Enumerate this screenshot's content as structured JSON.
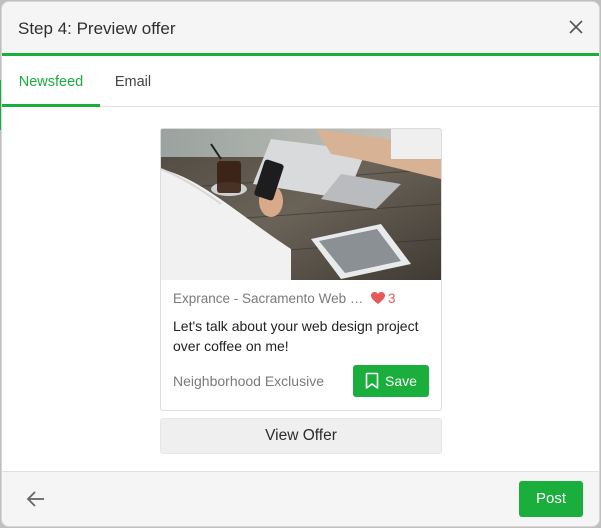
{
  "header": {
    "title": "Step 4: Preview offer",
    "close_icon": "close-icon"
  },
  "tabs": [
    {
      "label": "Newsfeed",
      "active": true
    },
    {
      "label": "Email",
      "active": false
    }
  ],
  "offer_card": {
    "image_icon": "photo-people-with-laptop-and-phone",
    "business_name": "Exprance - Sacramento Web Design",
    "likes_icon": "heart-icon",
    "likes_count": "3",
    "headline": "Let's talk about your web design project over coffee on me!",
    "footer_label": "Neighborhood Exclusive",
    "save_label": "Save",
    "save_icon": "bookmark-icon"
  },
  "view_offer_label": "View Offer",
  "footer": {
    "back_icon": "arrow-left-icon",
    "post_label": "Post"
  },
  "colors": {
    "accent": "#1aae3c",
    "heart": "#e65a5a",
    "header_bg": "#f5f5f5"
  }
}
